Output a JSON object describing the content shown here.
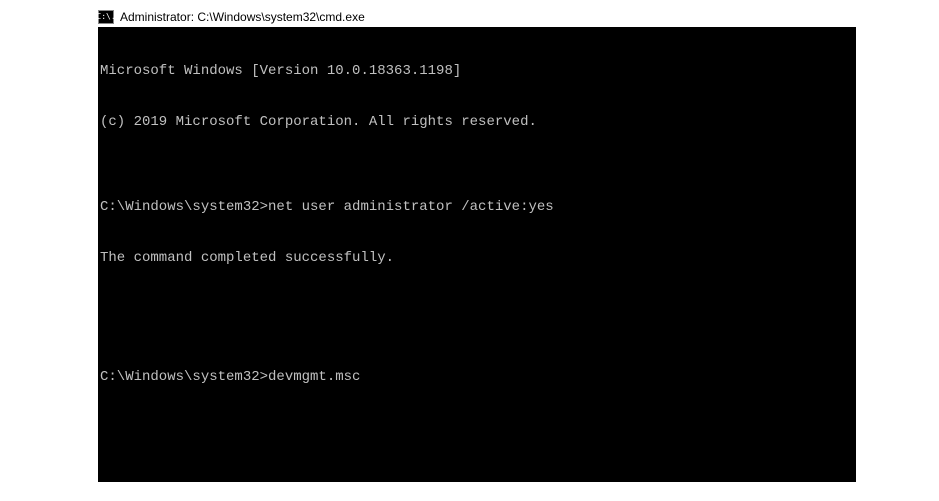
{
  "window": {
    "title": "Administrator: C:\\Windows\\system32\\cmd.exe",
    "icon_label": "C:\\."
  },
  "terminal": {
    "lines": [
      "Microsoft Windows [Version 10.0.18363.1198]",
      "(c) 2019 Microsoft Corporation. All rights reserved.",
      "",
      "C:\\Windows\\system32>net user administrator /active:yes",
      "The command completed successfully.",
      "",
      "",
      "C:\\Windows\\system32>devmgmt.msc"
    ],
    "current_prompt": "C:\\Windows\\system32>",
    "current_command": "devmgmt.msc"
  }
}
